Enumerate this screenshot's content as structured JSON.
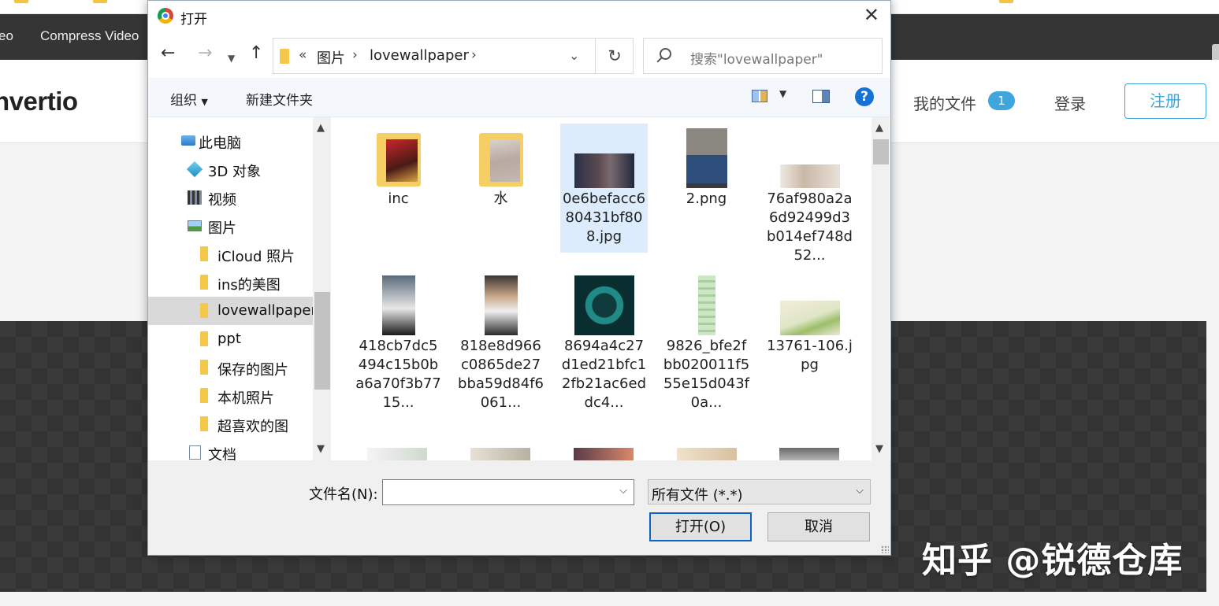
{
  "background": {
    "nav_links": [
      "eo",
      "Compress Video"
    ],
    "logo": "nvertio",
    "my_files": "我的文件",
    "my_files_count": "1",
    "login": "登录",
    "signup": "注册",
    "watermark": "知乎 @锐德仓库"
  },
  "dialog": {
    "title": "打开",
    "path": {
      "overflow": "«",
      "crumbs": [
        "图片",
        "lovewallpaper"
      ]
    },
    "search_placeholder": "搜索\"lovewallpaper\"",
    "toolbar": {
      "organize": "组织",
      "new_folder": "新建文件夹",
      "help": "?"
    },
    "nav_tree": [
      {
        "label": "此电脑",
        "icon": "computer-icon"
      },
      {
        "label": "3D 对象",
        "icon": "3d-objects-icon"
      },
      {
        "label": "视频",
        "icon": "video-icon"
      },
      {
        "label": "图片",
        "icon": "pictures-icon"
      },
      {
        "label": "iCloud 照片",
        "icon": "folder-icon"
      },
      {
        "label": "ins的美图",
        "icon": "folder-icon"
      },
      {
        "label": "lovewallpaper",
        "icon": "folder-icon",
        "selected": true
      },
      {
        "label": "ppt",
        "icon": "folder-icon"
      },
      {
        "label": "保存的图片",
        "icon": "folder-icon"
      },
      {
        "label": "本机照片",
        "icon": "folder-icon"
      },
      {
        "label": "超喜欢的图",
        "icon": "folder-icon"
      },
      {
        "label": "文档",
        "icon": "document-icon"
      }
    ],
    "files": [
      {
        "name": "inc",
        "kind": "folder"
      },
      {
        "name": "水",
        "kind": "folder"
      },
      {
        "name": "0e6befacc680431bf808.jpg",
        "kind": "image",
        "selected": true
      },
      {
        "name": "2.png",
        "kind": "image"
      },
      {
        "name": "76af980a2a6d92499d3b014ef748d52...",
        "kind": "image"
      },
      {
        "name": "418cb7dc5494c15b0ba6a70f3b7715...",
        "kind": "image"
      },
      {
        "name": "818e8d966c0865de27bba59d84f6061...",
        "kind": "image"
      },
      {
        "name": "8694a4c27d1ed21bfc12fb21ac6eddc4...",
        "kind": "image"
      },
      {
        "name": "9826_bfe2fbb020011f555e15d043f0a...",
        "kind": "image"
      },
      {
        "name": "13761-106.jpg",
        "kind": "image"
      }
    ],
    "filename_label": "文件名(N):",
    "filename_value": "",
    "filter_value": "所有文件 (*.*)",
    "open_button": "打开(O)",
    "cancel_button": "取消"
  },
  "colors": {
    "accent": "#3ea6dc",
    "selection": "#dcecfc",
    "primary_border": "#0a64c8"
  }
}
